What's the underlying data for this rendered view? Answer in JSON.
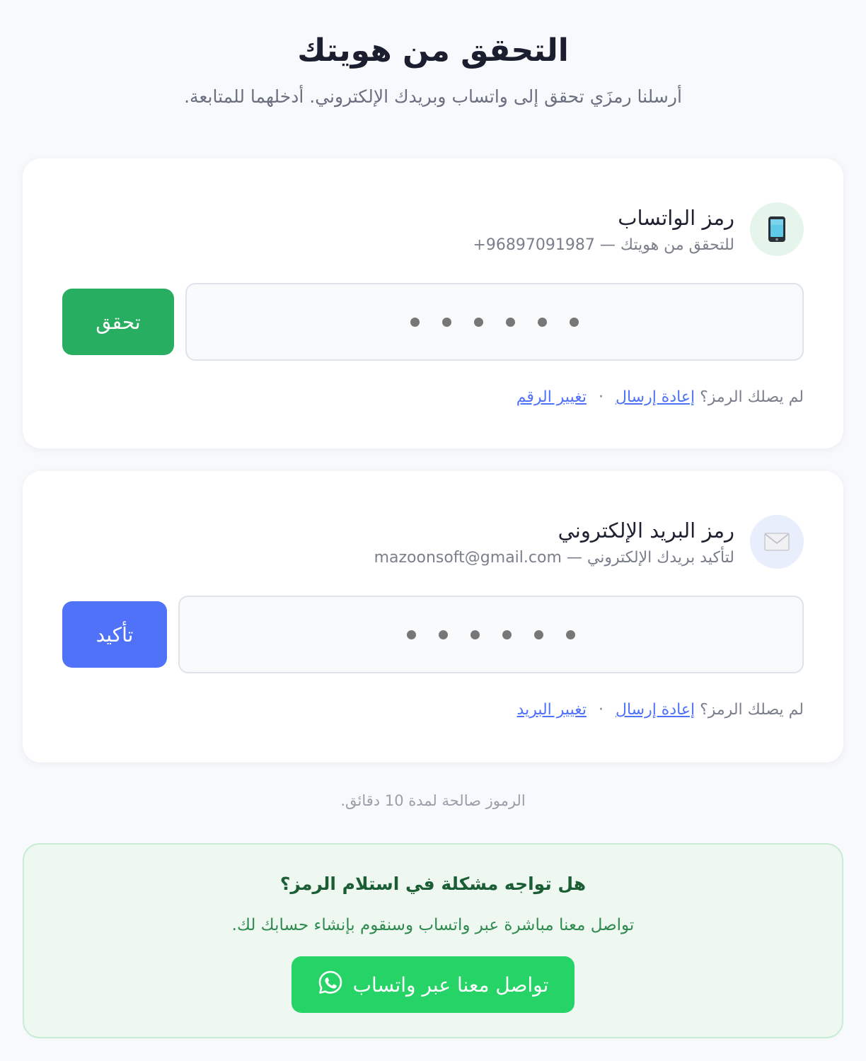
{
  "header": {
    "title": "التحقق من هويتك",
    "subtitle": "أرسلنا رمزَي تحقق إلى واتساب وبريدك الإلكتروني. أدخلهما للمتابعة."
  },
  "whatsapp_card": {
    "icon": "mobile-phone-icon",
    "title": "رمز الواتساب",
    "subtitle_prefix": "للتحقق من هويتك —",
    "phone": "+96897091987",
    "code_length": 6,
    "button_label": "تحقق",
    "help_prompt": "لم يصلك الرمز؟",
    "resend_label": "إعادة إرسال",
    "separator": "·",
    "change_label": "تغيير الرقم"
  },
  "email_card": {
    "icon": "envelope-icon",
    "title": "رمز البريد الإلكتروني",
    "subtitle_prefix": "لتأكيد بريدك الإلكتروني —",
    "email": "mazoonsoft@gmail.com",
    "code_length": 6,
    "button_label": "تأكيد",
    "help_prompt": "لم يصلك الرمز؟",
    "resend_label": "إعادة إرسال",
    "separator": "·",
    "change_label": "تغيير البريد"
  },
  "validity_note": "الرموز صالحة لمدة 10 دقائق.",
  "support": {
    "title": "هل تواجه مشكلة في استلام الرمز؟",
    "text": "تواصل معنا مباشرة عبر واتساب وسنقوم بإنشاء حسابك لك.",
    "button_label": "تواصل معنا عبر واتساب",
    "button_icon": "whatsapp-icon"
  },
  "colors": {
    "verify_button": "#27ae60",
    "confirm_button": "#4f72f8",
    "link": "#4f72f8",
    "whatsapp_button": "#25d366"
  }
}
